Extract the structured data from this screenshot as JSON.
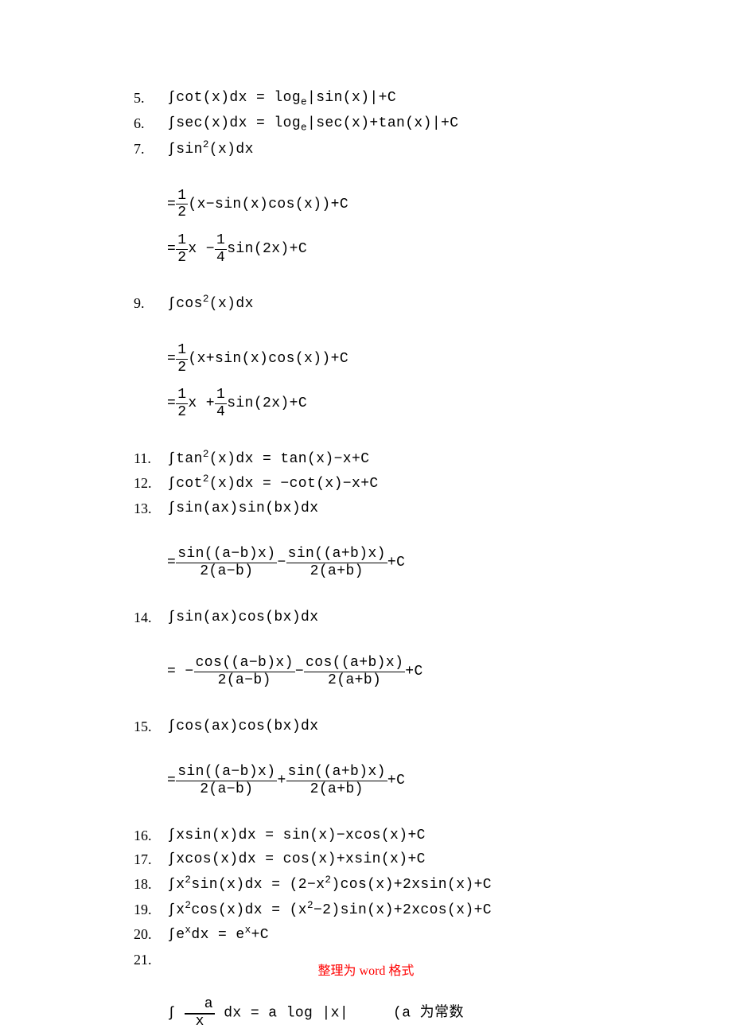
{
  "items": {
    "i5": {
      "num": "5.",
      "lhs": "∫cot(x)dx = log",
      "sub": "e",
      "rhs": "|sin(x)|+C"
    },
    "i6": {
      "num": "6.",
      "lhs": "∫sec(x)dx = log",
      "sub": "e",
      "rhs": "|sec(x)+tan(x)|+C"
    },
    "i7": {
      "num": "7.",
      "lhs_a": "∫sin",
      "lhs_b": "(x)dx"
    },
    "b7a": {
      "mid": "(x−sin(x)cos(x))+C"
    },
    "b7b": {
      "mid1": "x −",
      "mid2": "sin(2x)+C"
    },
    "i9": {
      "num": "9.",
      "lhs_a": "∫cos",
      "lhs_b": "(x)dx"
    },
    "b9a": {
      "mid": "(x+sin(x)cos(x))+C"
    },
    "b9b": {
      "mid1": "x +",
      "mid2": "sin(2x)+C"
    },
    "i11": {
      "num": "11.",
      "lhs_a": "∫tan",
      "lhs_b": "(x)dx = tan(x)−x+C"
    },
    "i12": {
      "num": "12.",
      "lhs_a": "∫cot",
      "lhs_b": "(x)dx = −cot(x)−x+C"
    },
    "i13": {
      "num": "13.",
      "lhs": "∫sin(ax)sin(bx)dx"
    },
    "b13": {
      "n1": "sin((a−b)x)",
      "d1": "2(a−b)",
      "n2": "sin((a+b)x)",
      "d2": "2(a+b)",
      "tail": "+C"
    },
    "i14": {
      "num": "14.",
      "lhs": "∫sin(ax)cos(bx)dx"
    },
    "b14": {
      "pre": "= −",
      "n1": "cos((a−b)x)",
      "d1": "2(a−b)",
      "n2": "cos((a+b)x)",
      "d2": "2(a+b)",
      "tail": "+C"
    },
    "i15": {
      "num": "15.",
      "lhs": "∫cos(ax)cos(bx)dx"
    },
    "b15": {
      "n1": "sin((a−b)x)",
      "d1": "2(a−b)",
      "n2": "sin((a+b)x)",
      "d2": "2(a+b)",
      "tail": "+C"
    },
    "i16": {
      "num": "16.",
      "lhs": "∫xsin(x)dx = sin(x)−xcos(x)+C"
    },
    "i17": {
      "num": "17.",
      "lhs": "∫xcos(x)dx = cos(x)+xsin(x)+C"
    },
    "i18": {
      "num": "18.",
      "lhs_a": "∫x",
      "lhs_b": "sin(x)dx = (2−x",
      "lhs_c": ")cos(x)+2xsin(x)+C"
    },
    "i19": {
      "num": "19.",
      "lhs_a": "∫x",
      "lhs_b": "cos(x)dx = (x",
      "lhs_c": "−2)sin(x)+2xcos(x)+C"
    },
    "i20": {
      "num": "20.",
      "lhs_a": "∫e",
      "sup": "x",
      "lhs_b": "dx = e",
      "lhs_c": "+C"
    },
    "i21": {
      "num": "21."
    },
    "b21": {
      "int": "∫",
      "top": "  a",
      "mid": "",
      "bot": "x",
      "rest": "dx = a log |x|     (a 为常数"
    }
  },
  "fracs": {
    "half": {
      "n": "1",
      "d": "2"
    },
    "quarter": {
      "n": "1",
      "d": "4"
    }
  },
  "sup2": "2",
  "footer": "整理为 word 格式"
}
